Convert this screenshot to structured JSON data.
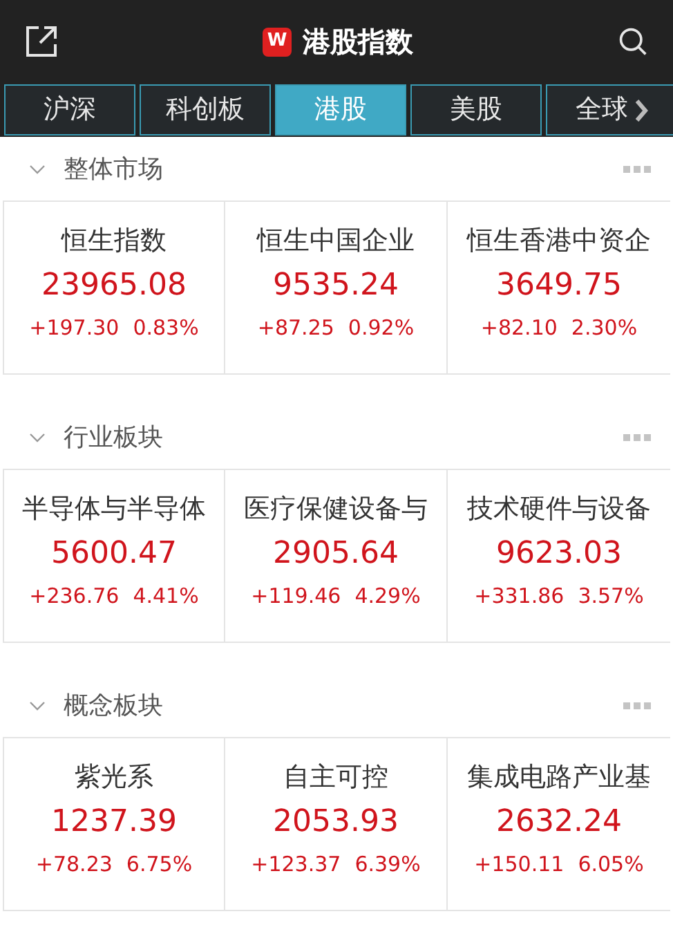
{
  "header": {
    "title": "港股指数",
    "logo": "W"
  },
  "tabs": [
    {
      "label": "沪深",
      "selected": false
    },
    {
      "label": "科创板",
      "selected": false
    },
    {
      "label": "港股",
      "selected": true
    },
    {
      "label": "美股",
      "selected": false
    },
    {
      "label": "全球",
      "selected": false,
      "more": true
    }
  ],
  "sections": [
    {
      "title": "整体市场",
      "expanded": true,
      "cards": [
        {
          "name": "恒生指数",
          "value": "23965.08",
          "change": "+197.30",
          "percent": "0.83%"
        },
        {
          "name": "恒生中国企业",
          "value": "9535.24",
          "change": "+87.25",
          "percent": "0.92%"
        },
        {
          "name": "恒生香港中资企",
          "value": "3649.75",
          "change": "+82.10",
          "percent": "2.30%"
        }
      ]
    },
    {
      "title": "行业板块",
      "expanded": true,
      "cards": [
        {
          "name": "半导体与半导体",
          "value": "5600.47",
          "change": "+236.76",
          "percent": "4.41%"
        },
        {
          "name": "医疗保健设备与",
          "value": "2905.64",
          "change": "+119.46",
          "percent": "4.29%"
        },
        {
          "name": "技术硬件与设备",
          "value": "9623.03",
          "change": "+331.86",
          "percent": "3.57%"
        }
      ]
    },
    {
      "title": "概念板块",
      "expanded": true,
      "cards": [
        {
          "name": "紫光系",
          "value": "1237.39",
          "change": "+78.23",
          "percent": "6.75%"
        },
        {
          "name": "自主可控",
          "value": "2053.93",
          "change": "+123.37",
          "percent": "6.39%"
        },
        {
          "name": "集成电路产业基",
          "value": "2632.24",
          "change": "+150.11",
          "percent": "6.05%"
        }
      ]
    }
  ]
}
